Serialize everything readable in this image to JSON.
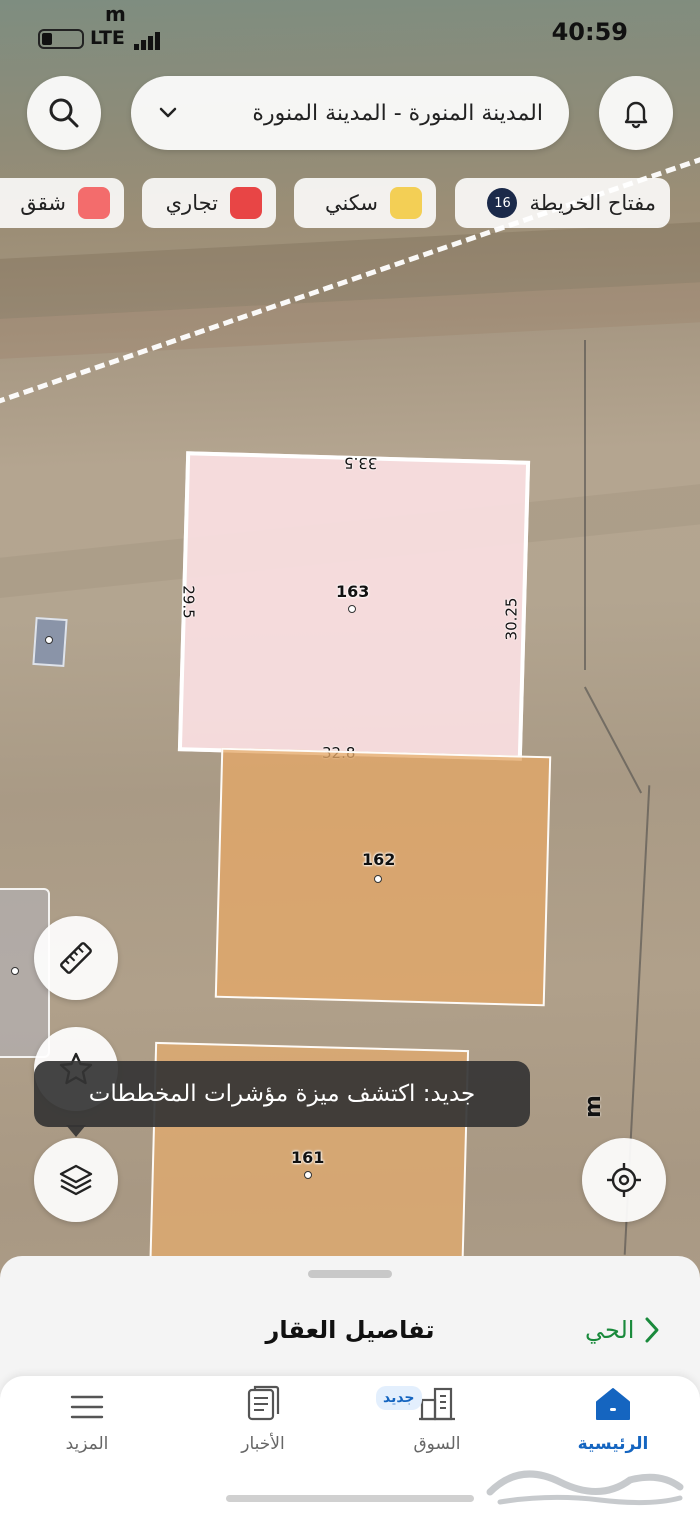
{
  "status_bar": {
    "carrier": "m",
    "network": "LTE",
    "time": "40:59"
  },
  "header": {
    "city_select_value": "المدينة المنورة - المدينة المنورة",
    "search_icon": "search-icon",
    "bell_icon": "bell-icon"
  },
  "legend": {
    "key_label": "مفتاح الخريطة",
    "key_count": "16",
    "items": [
      {
        "label": "سكني",
        "color": "#f3cf55"
      },
      {
        "label": "تجاري",
        "color": "#e84545"
      },
      {
        "label": "شقق",
        "color": "#f36c6c"
      }
    ]
  },
  "parcels": [
    {
      "number": "163",
      "dims": {
        "top": "33.5",
        "left": "29.5",
        "right": "30.25",
        "bottom": "32.8"
      }
    },
    {
      "number": "162"
    },
    {
      "number": "161"
    }
  ],
  "map_letters": {
    "right_m": "m"
  },
  "tooltip": {
    "text": "جديد: اكتشف ميزة مؤشرات المخططات"
  },
  "sheet": {
    "title": "تفاصيل العقار",
    "district_link": "الحي"
  },
  "tabs": [
    {
      "label": "الرئيسية",
      "icon": "home-icon",
      "active": true
    },
    {
      "label": "السوق",
      "icon": "buildings-icon",
      "badge": "جديد"
    },
    {
      "label": "الأخبار",
      "icon": "news-icon"
    },
    {
      "label": "المزيد",
      "icon": "menu-icon"
    }
  ],
  "colors": {
    "accent": "#1565c0",
    "district_link": "#1a8a3c",
    "parcel_163": "#fce1e4",
    "parcel_162": "#e4a868"
  }
}
